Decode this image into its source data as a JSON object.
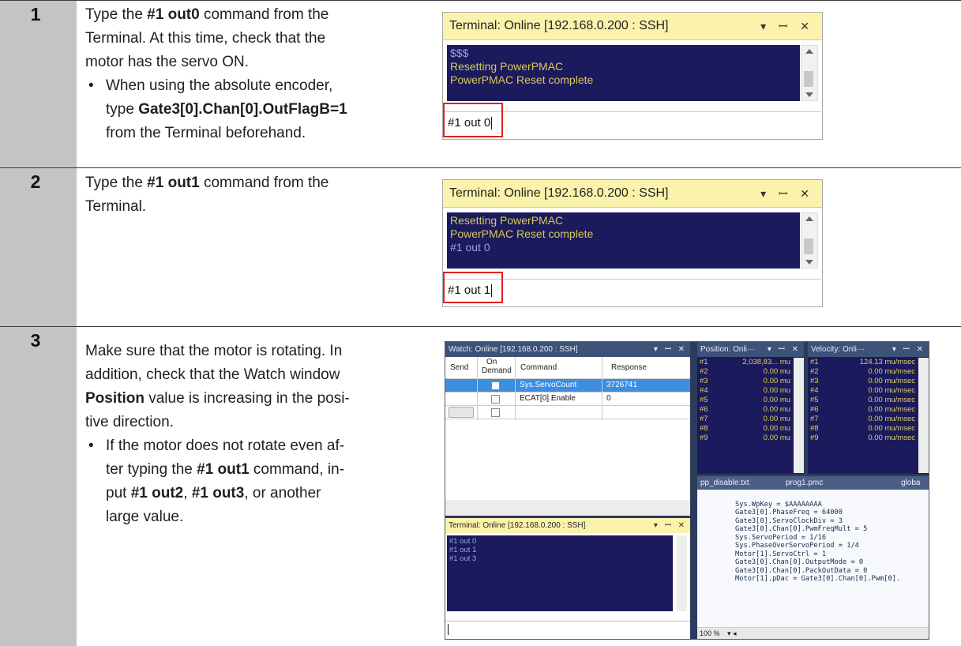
{
  "steps": [
    {
      "number": "1",
      "line1_pre": "Type the ",
      "line1_bold": "#1 out0",
      "line1_post": " command from the",
      "line2": "Terminal. At this time, check that the",
      "line3": "motor has the servo ON.",
      "bullet_line1": "When using the absolute encoder,",
      "bullet_line2_pre": "type ",
      "bullet_line2_bold": "Gate3[0].Chan[0].OutFlagB=1",
      "bullet_line3": "from the Terminal beforehand."
    },
    {
      "number": "2",
      "line1_pre": "Type the ",
      "line1_bold": "#1 out1",
      "line1_post": " command from the",
      "line2": "Terminal."
    },
    {
      "number": "3",
      "line1": "Make sure that the motor is rotating. In",
      "line2": "addition, check that the Watch window",
      "line3_bold": "Position",
      "line3_post": " value is increasing in the posi-",
      "line4": "tive direction.",
      "bullet_line1": "If the motor does not rotate even af-",
      "bullet_line2_pre": "ter typing the ",
      "bullet_line2_bold": "#1 out1",
      "bullet_line2_post": " command, in-",
      "bullet_line3_pre": "put ",
      "bullet_line3_bold1": "#1 out2",
      "bullet_line3_mid": ", ",
      "bullet_line3_bold2": "#1 out3",
      "bullet_line3_post": ", or another",
      "bullet_line4": "large value."
    }
  ],
  "bullet_glyph": "•",
  "terminal1": {
    "title": "Terminal: Online [192.168.0.200 : SSH]",
    "controls": "▾ ꟷ ✕",
    "lines": [
      "$$$",
      "Resetting PowerPMAC",
      "PowerPMAC Reset complete"
    ],
    "input": "#1 out 0"
  },
  "terminal2": {
    "title": "Terminal: Online [192.168.0.200 : SSH]",
    "controls": "▾ ꟷ ✕",
    "lines": [
      "Resetting PowerPMAC",
      "PowerPMAC Reset complete",
      "#1 out 0"
    ],
    "input": "#1 out 1"
  },
  "ide": {
    "watch_title": "Watch: Online [192.168.0.200 : SSH]",
    "watch_cols": {
      "send": "Send",
      "on_demand_1": "On",
      "on_demand_2": "Demand",
      "command": "Command",
      "response": "Response"
    },
    "watch_rows": [
      {
        "command": "Sys.ServoCount",
        "response": "3726741"
      },
      {
        "command": "ECAT[0].Enable",
        "response": "0"
      },
      {
        "command": "",
        "response": ""
      }
    ],
    "position_title": "Position: Onli···",
    "position_rows": [
      {
        "k": "#1",
        "v": "2,038,83... mu"
      },
      {
        "k": "#2",
        "v": "0.00 mu"
      },
      {
        "k": "#3",
        "v": "0.00 mu"
      },
      {
        "k": "#4",
        "v": "0.00 mu"
      },
      {
        "k": "#5",
        "v": "0.00 mu"
      },
      {
        "k": "#6",
        "v": "0.00 mu"
      },
      {
        "k": "#7",
        "v": "0.00 mu"
      },
      {
        "k": "#8",
        "v": "0.00 mu"
      },
      {
        "k": "#9",
        "v": "0.00 mu"
      }
    ],
    "velocity_title": "Velocity: Onli···",
    "velocity_rows": [
      {
        "k": "#1",
        "v": "124.13 mu/msec"
      },
      {
        "k": "#2",
        "v": "0.00 mu/msec"
      },
      {
        "k": "#3",
        "v": "0.00 mu/msec"
      },
      {
        "k": "#4",
        "v": "0.00 mu/msec"
      },
      {
        "k": "#5",
        "v": "0.00 mu/msec"
      },
      {
        "k": "#6",
        "v": "0.00 mu/msec"
      },
      {
        "k": "#7",
        "v": "0.00 mu/msec"
      },
      {
        "k": "#8",
        "v": "0.00 mu/msec"
      },
      {
        "k": "#9",
        "v": "0.00 mu/msec"
      }
    ],
    "tabs": [
      "pp_disable.txt",
      "prog1.pmc",
      "globa"
    ],
    "code_lines": [
      "Sys.WpKey = $AAAAAAAA",
      "",
      "Gate3[0].PhaseFreq = 64000",
      "Gate3[0].ServoClockDiv = 3",
      "Gate3[0].Chan[0].PwmFreqMult = 5",
      "Sys.ServoPeriod = 1/16",
      "Sys.PhaseOverServoPeriod = 1/4",
      "Motor[1].ServoCtrl = 1",
      "Gate3[0].Chan[0].OutputMode = 0",
      "Gate3[0].Chan[0].PackOutData = 0",
      "Motor[1].pDac = Gate3[0].Chan[0].Pwm[0]."
    ],
    "zoom": "100 %",
    "terminal_title": "Terminal: Online [192.168.0.200 : SSH]",
    "terminal_lines": [
      "#1 out 0",
      "#1 out 1",
      "#1 out 3"
    ]
  },
  "colors": {
    "terminal_bg": "#1b1a5c",
    "terminal_title_bg": "#fbf3ab",
    "number_column": "#c4c4c4",
    "highlight": "#e0201e"
  }
}
